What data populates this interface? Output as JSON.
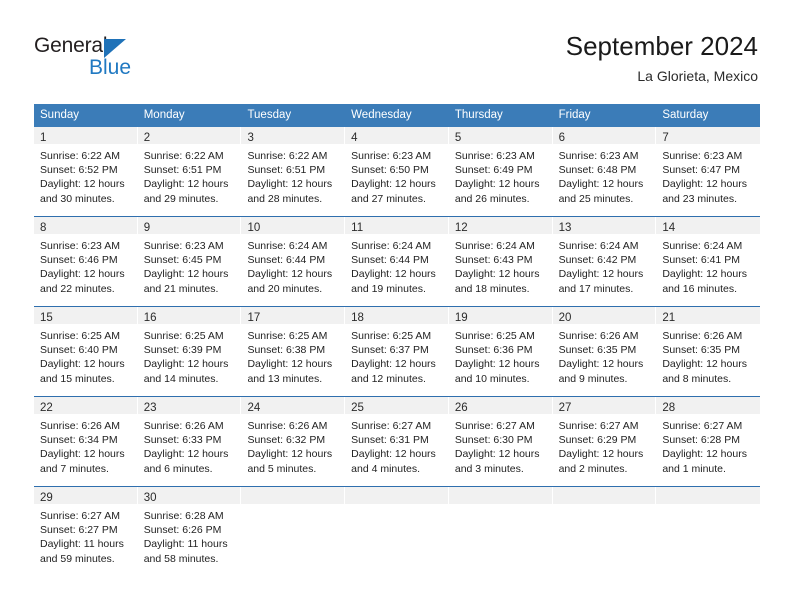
{
  "logo": {
    "word_top": "General",
    "word_bottom": "Blue",
    "triangle_color": "#1f72b8",
    "blue_color": "#2079c2"
  },
  "header": {
    "title": "September 2024",
    "subtitle": "La Glorieta, Mexico"
  },
  "theme": {
    "header_bg": "#3b7cb8",
    "day_band_bg": "#f1f1f1",
    "row_border": "#2f6fae"
  },
  "weekdays": [
    "Sunday",
    "Monday",
    "Tuesday",
    "Wednesday",
    "Thursday",
    "Friday",
    "Saturday"
  ],
  "weeks": [
    [
      {
        "day": "1",
        "sunrise": "Sunrise: 6:22 AM",
        "sunset": "Sunset: 6:52 PM",
        "daylight1": "Daylight: 12 hours",
        "daylight2": "and 30 minutes."
      },
      {
        "day": "2",
        "sunrise": "Sunrise: 6:22 AM",
        "sunset": "Sunset: 6:51 PM",
        "daylight1": "Daylight: 12 hours",
        "daylight2": "and 29 minutes."
      },
      {
        "day": "3",
        "sunrise": "Sunrise: 6:22 AM",
        "sunset": "Sunset: 6:51 PM",
        "daylight1": "Daylight: 12 hours",
        "daylight2": "and 28 minutes."
      },
      {
        "day": "4",
        "sunrise": "Sunrise: 6:23 AM",
        "sunset": "Sunset: 6:50 PM",
        "daylight1": "Daylight: 12 hours",
        "daylight2": "and 27 minutes."
      },
      {
        "day": "5",
        "sunrise": "Sunrise: 6:23 AM",
        "sunset": "Sunset: 6:49 PM",
        "daylight1": "Daylight: 12 hours",
        "daylight2": "and 26 minutes."
      },
      {
        "day": "6",
        "sunrise": "Sunrise: 6:23 AM",
        "sunset": "Sunset: 6:48 PM",
        "daylight1": "Daylight: 12 hours",
        "daylight2": "and 25 minutes."
      },
      {
        "day": "7",
        "sunrise": "Sunrise: 6:23 AM",
        "sunset": "Sunset: 6:47 PM",
        "daylight1": "Daylight: 12 hours",
        "daylight2": "and 23 minutes."
      }
    ],
    [
      {
        "day": "8",
        "sunrise": "Sunrise: 6:23 AM",
        "sunset": "Sunset: 6:46 PM",
        "daylight1": "Daylight: 12 hours",
        "daylight2": "and 22 minutes."
      },
      {
        "day": "9",
        "sunrise": "Sunrise: 6:23 AM",
        "sunset": "Sunset: 6:45 PM",
        "daylight1": "Daylight: 12 hours",
        "daylight2": "and 21 minutes."
      },
      {
        "day": "10",
        "sunrise": "Sunrise: 6:24 AM",
        "sunset": "Sunset: 6:44 PM",
        "daylight1": "Daylight: 12 hours",
        "daylight2": "and 20 minutes."
      },
      {
        "day": "11",
        "sunrise": "Sunrise: 6:24 AM",
        "sunset": "Sunset: 6:44 PM",
        "daylight1": "Daylight: 12 hours",
        "daylight2": "and 19 minutes."
      },
      {
        "day": "12",
        "sunrise": "Sunrise: 6:24 AM",
        "sunset": "Sunset: 6:43 PM",
        "daylight1": "Daylight: 12 hours",
        "daylight2": "and 18 minutes."
      },
      {
        "day": "13",
        "sunrise": "Sunrise: 6:24 AM",
        "sunset": "Sunset: 6:42 PM",
        "daylight1": "Daylight: 12 hours",
        "daylight2": "and 17 minutes."
      },
      {
        "day": "14",
        "sunrise": "Sunrise: 6:24 AM",
        "sunset": "Sunset: 6:41 PM",
        "daylight1": "Daylight: 12 hours",
        "daylight2": "and 16 minutes."
      }
    ],
    [
      {
        "day": "15",
        "sunrise": "Sunrise: 6:25 AM",
        "sunset": "Sunset: 6:40 PM",
        "daylight1": "Daylight: 12 hours",
        "daylight2": "and 15 minutes."
      },
      {
        "day": "16",
        "sunrise": "Sunrise: 6:25 AM",
        "sunset": "Sunset: 6:39 PM",
        "daylight1": "Daylight: 12 hours",
        "daylight2": "and 14 minutes."
      },
      {
        "day": "17",
        "sunrise": "Sunrise: 6:25 AM",
        "sunset": "Sunset: 6:38 PM",
        "daylight1": "Daylight: 12 hours",
        "daylight2": "and 13 minutes."
      },
      {
        "day": "18",
        "sunrise": "Sunrise: 6:25 AM",
        "sunset": "Sunset: 6:37 PM",
        "daylight1": "Daylight: 12 hours",
        "daylight2": "and 12 minutes."
      },
      {
        "day": "19",
        "sunrise": "Sunrise: 6:25 AM",
        "sunset": "Sunset: 6:36 PM",
        "daylight1": "Daylight: 12 hours",
        "daylight2": "and 10 minutes."
      },
      {
        "day": "20",
        "sunrise": "Sunrise: 6:26 AM",
        "sunset": "Sunset: 6:35 PM",
        "daylight1": "Daylight: 12 hours",
        "daylight2": "and 9 minutes."
      },
      {
        "day": "21",
        "sunrise": "Sunrise: 6:26 AM",
        "sunset": "Sunset: 6:35 PM",
        "daylight1": "Daylight: 12 hours",
        "daylight2": "and 8 minutes."
      }
    ],
    [
      {
        "day": "22",
        "sunrise": "Sunrise: 6:26 AM",
        "sunset": "Sunset: 6:34 PM",
        "daylight1": "Daylight: 12 hours",
        "daylight2": "and 7 minutes."
      },
      {
        "day": "23",
        "sunrise": "Sunrise: 6:26 AM",
        "sunset": "Sunset: 6:33 PM",
        "daylight1": "Daylight: 12 hours",
        "daylight2": "and 6 minutes."
      },
      {
        "day": "24",
        "sunrise": "Sunrise: 6:26 AM",
        "sunset": "Sunset: 6:32 PM",
        "daylight1": "Daylight: 12 hours",
        "daylight2": "and 5 minutes."
      },
      {
        "day": "25",
        "sunrise": "Sunrise: 6:27 AM",
        "sunset": "Sunset: 6:31 PM",
        "daylight1": "Daylight: 12 hours",
        "daylight2": "and 4 minutes."
      },
      {
        "day": "26",
        "sunrise": "Sunrise: 6:27 AM",
        "sunset": "Sunset: 6:30 PM",
        "daylight1": "Daylight: 12 hours",
        "daylight2": "and 3 minutes."
      },
      {
        "day": "27",
        "sunrise": "Sunrise: 6:27 AM",
        "sunset": "Sunset: 6:29 PM",
        "daylight1": "Daylight: 12 hours",
        "daylight2": "and 2 minutes."
      },
      {
        "day": "28",
        "sunrise": "Sunrise: 6:27 AM",
        "sunset": "Sunset: 6:28 PM",
        "daylight1": "Daylight: 12 hours",
        "daylight2": "and 1 minute."
      }
    ],
    [
      {
        "day": "29",
        "sunrise": "Sunrise: 6:27 AM",
        "sunset": "Sunset: 6:27 PM",
        "daylight1": "Daylight: 11 hours",
        "daylight2": "and 59 minutes."
      },
      {
        "day": "30",
        "sunrise": "Sunrise: 6:28 AM",
        "sunset": "Sunset: 6:26 PM",
        "daylight1": "Daylight: 11 hours",
        "daylight2": "and 58 minutes."
      },
      {
        "day": "",
        "sunrise": "",
        "sunset": "",
        "daylight1": "",
        "daylight2": ""
      },
      {
        "day": "",
        "sunrise": "",
        "sunset": "",
        "daylight1": "",
        "daylight2": ""
      },
      {
        "day": "",
        "sunrise": "",
        "sunset": "",
        "daylight1": "",
        "daylight2": ""
      },
      {
        "day": "",
        "sunrise": "",
        "sunset": "",
        "daylight1": "",
        "daylight2": ""
      },
      {
        "day": "",
        "sunrise": "",
        "sunset": "",
        "daylight1": "",
        "daylight2": ""
      }
    ]
  ]
}
